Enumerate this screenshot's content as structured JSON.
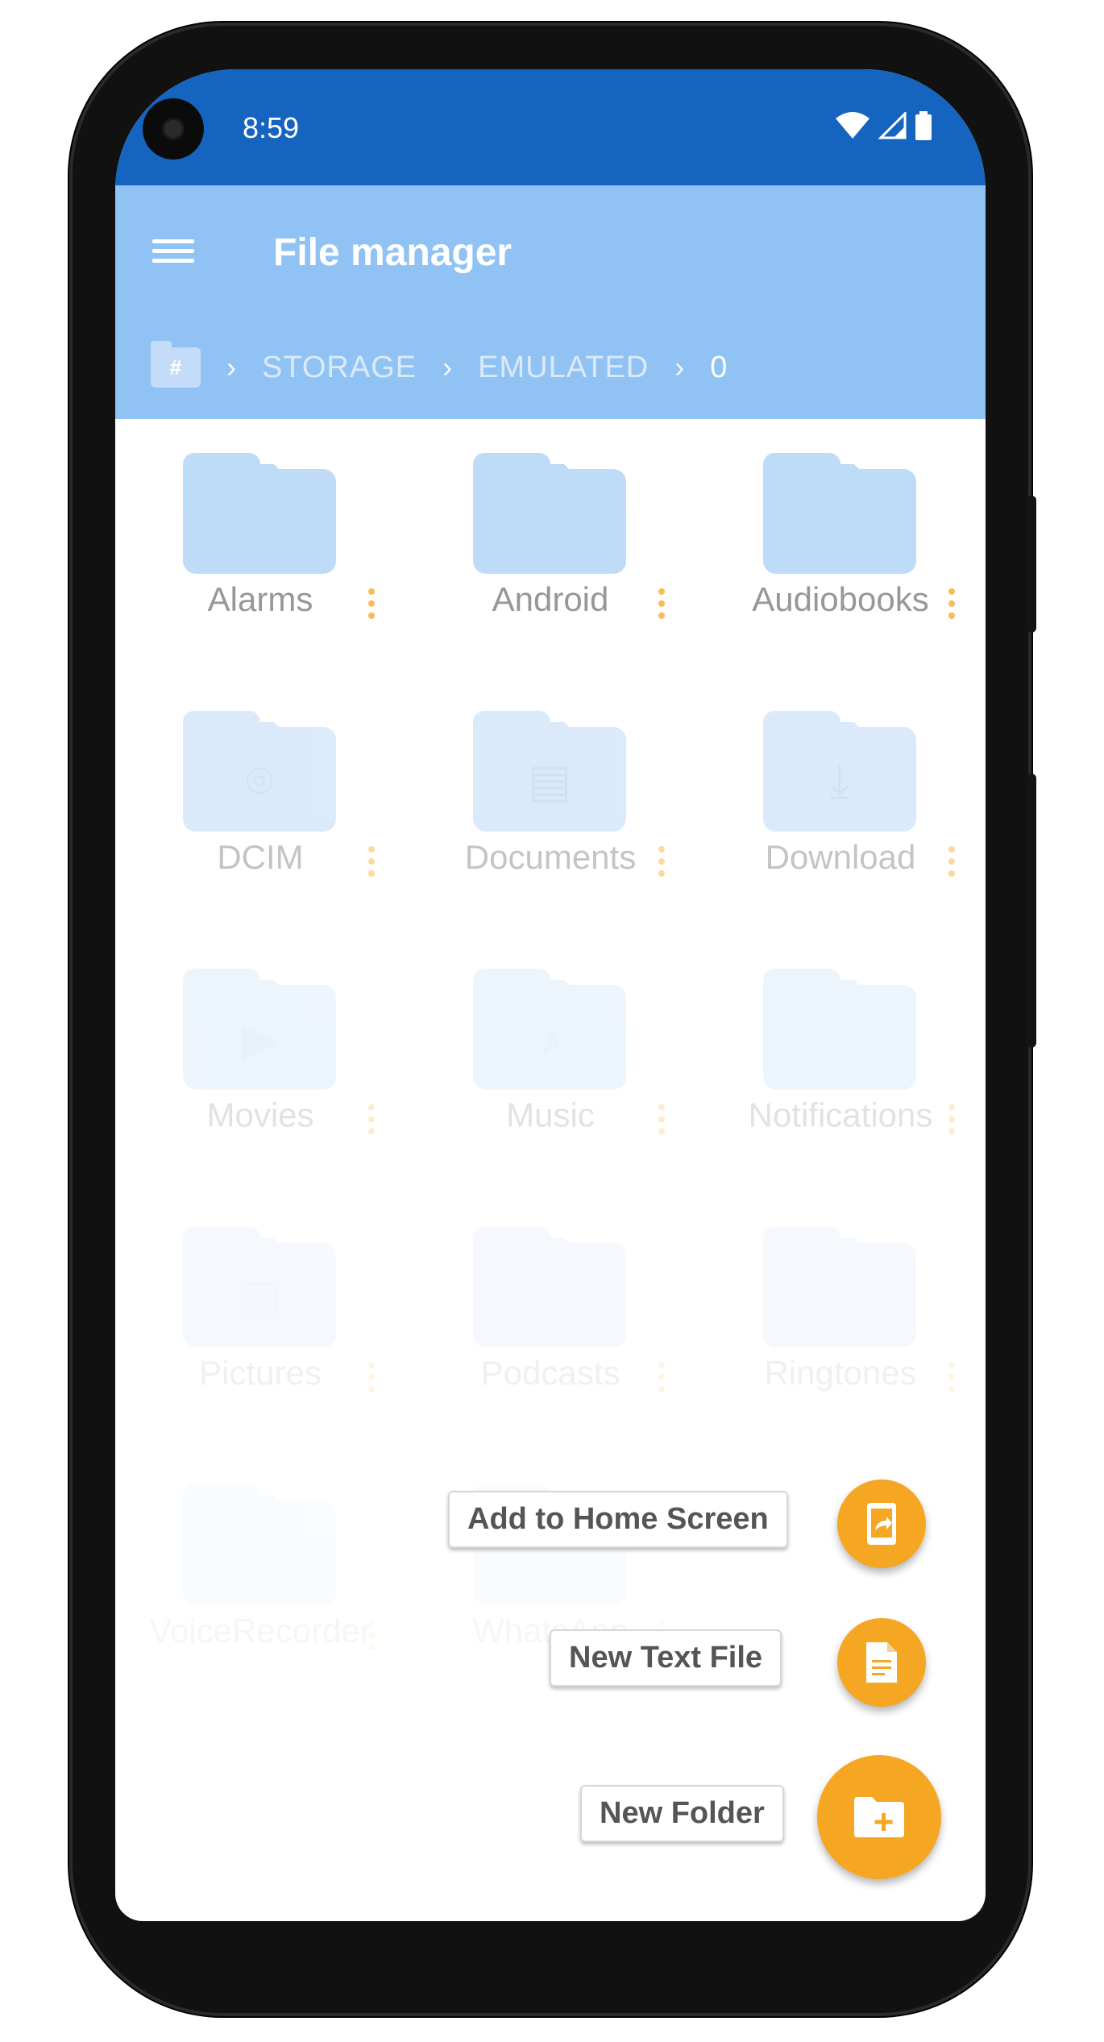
{
  "status_bar": {
    "time": "8:59",
    "icons": [
      "wifi-icon",
      "signal-icon",
      "battery-icon"
    ]
  },
  "app_bar": {
    "title": "File manager",
    "menu_icon": "hamburger-icon"
  },
  "breadcrumb": {
    "root_icon": "storage-root-icon",
    "root_glyph": "#",
    "items": [
      "STORAGE",
      "EMULATED",
      "0"
    ]
  },
  "folders": [
    {
      "name": "Alarms",
      "glyph": ""
    },
    {
      "name": "Android",
      "glyph": ""
    },
    {
      "name": "Audiobooks",
      "glyph": ""
    },
    {
      "name": "DCIM",
      "glyph": "camera-icon"
    },
    {
      "name": "Documents",
      "glyph": "document-icon"
    },
    {
      "name": "Download",
      "glyph": "download-icon"
    },
    {
      "name": "Movies",
      "glyph": "movie-icon"
    },
    {
      "name": "Music",
      "glyph": "music-icon"
    },
    {
      "name": "Notifications",
      "glyph": ""
    },
    {
      "name": "Pictures",
      "glyph": "image-icon"
    },
    {
      "name": "Podcasts",
      "glyph": ""
    },
    {
      "name": "Ringtones",
      "glyph": ""
    },
    {
      "name": "VoiceRecorder",
      "glyph": ""
    },
    {
      "name": "WhatsApp",
      "glyph": ""
    }
  ],
  "fab_menu": {
    "add_to_home_label": "Add to Home Screen",
    "new_text_file_label": "New Text File",
    "new_folder_label": "New Folder"
  },
  "colors": {
    "status_bar": "#1565c0",
    "app_bar": "#90c3f3",
    "folder": "#a9cff5",
    "accent": "#f5a623"
  }
}
